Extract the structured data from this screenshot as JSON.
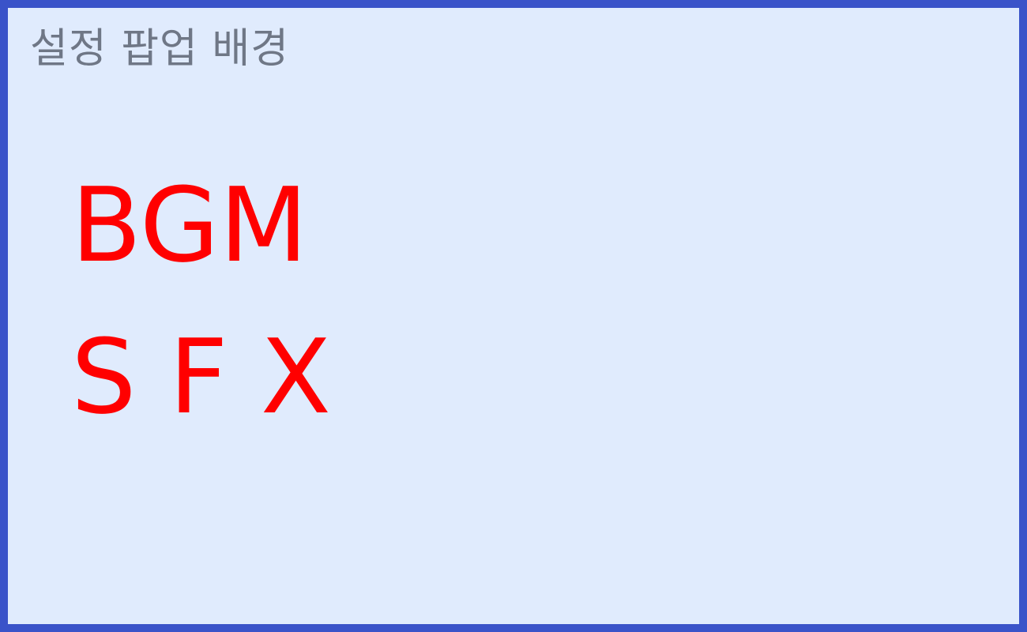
{
  "popup": {
    "title": "설정 팝업 배경",
    "options": {
      "bgm_label": "BGM",
      "sfx_label": "S F X"
    }
  },
  "colors": {
    "border": "#3a53c9",
    "background": "#e0ebfd",
    "title_text": "#6f7786",
    "option_text": "#ff0000"
  }
}
